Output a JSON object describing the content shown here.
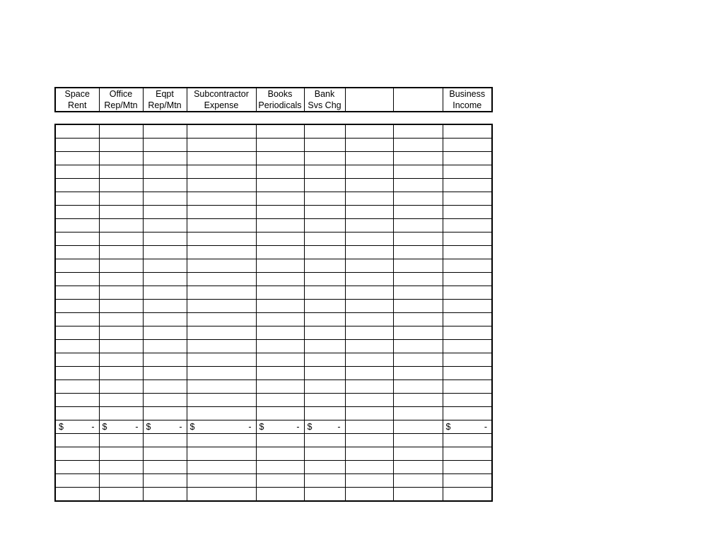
{
  "headers": [
    {
      "line1": "Space",
      "line2": "Rent"
    },
    {
      "line1": "Office",
      "line2": "Rep/Mtn"
    },
    {
      "line1": "Eqpt",
      "line2": "Rep/Mtn"
    },
    {
      "line1": "Subcontractor",
      "line2": "Expense"
    },
    {
      "line1": "Books",
      "line2": "Periodicals"
    },
    {
      "line1": "Bank",
      "line2": "Svs Chg"
    },
    {
      "line1": "",
      "line2": ""
    },
    {
      "line1": "",
      "line2": ""
    },
    {
      "line1": "Business",
      "line2": "Income"
    }
  ],
  "totals_row_index": 22,
  "money_symbol": "$",
  "money_dash": "-",
  "totals": [
    {
      "has_value": true
    },
    {
      "has_value": true
    },
    {
      "has_value": true
    },
    {
      "has_value": true
    },
    {
      "has_value": true
    },
    {
      "has_value": true
    },
    {
      "has_value": false
    },
    {
      "has_value": false
    },
    {
      "has_value": true
    }
  ],
  "body_row_count": 28,
  "column_count": 9
}
